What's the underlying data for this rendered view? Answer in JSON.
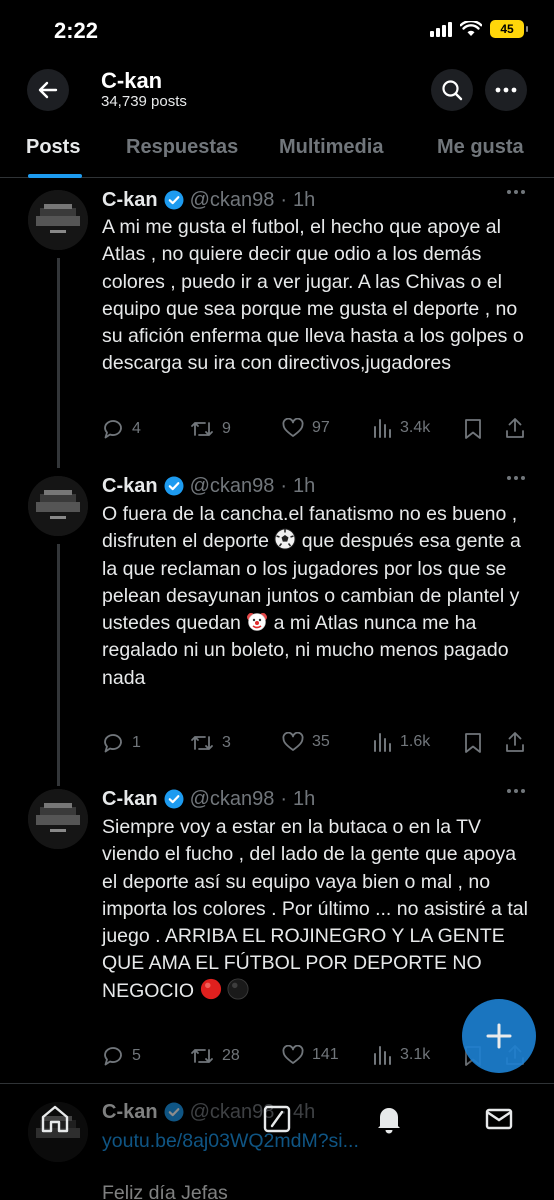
{
  "status_bar": {
    "time": "2:22",
    "battery": "45"
  },
  "header": {
    "title": "C-kan",
    "subtitle": "34,739 posts"
  },
  "tabs": [
    {
      "label": "Posts",
      "active": true
    },
    {
      "label": "Respuestas"
    },
    {
      "label": "Multimedia"
    },
    {
      "label": "Me gusta"
    }
  ],
  "posts": [
    {
      "name": "C-kan",
      "handle": "@ckan98",
      "age": "1h",
      "text": "A mi me gusta el futbol, el hecho que apoye al Atlas , no quiere decir que odio a los demás colores , puedo ir a ver jugar. A las Chivas o el equipo que sea porque me gusta el deporte , no su afición enferma que lleva hasta a los golpes o descarga su ira con directivos,jugadores",
      "replies": "4",
      "reposts": "9",
      "likes": "97",
      "views": "3.4k"
    },
    {
      "name": "C-kan",
      "handle": "@ckan98",
      "age": "1h",
      "text_a": "O fuera de la cancha.el fanatismo no es bueno , disfruten el deporte ",
      "text_b": " que después esa gente a la que reclaman o los jugadores por los que se pelean desayunan juntos o cambian de plantel y ustedes quedan ",
      "text_c": " a mi Atlas nunca me ha regalado ni un boleto, ni mucho menos pagado nada",
      "emoji_1": "soccer-ball-emoji",
      "emoji_2": "clown-face-emoji",
      "replies": "1",
      "reposts": "3",
      "likes": "35",
      "views": "1.6k"
    },
    {
      "name": "C-kan",
      "handle": "@ckan98",
      "age": "1h",
      "text": "Siempre voy a estar en la butaca o en la TV viendo el fucho , del lado de la gente que apoya el deporte así su equipo vaya bien o mal , no importa los colores . Por último ... no asistiré a tal juego . ARRIBA EL ROJINEGRO Y LA GENTE QUE AMA EL FÚTBOL POR DEPORTE NO NEGOCIO ",
      "emoji_1": "red-circle-emoji",
      "emoji_2": "black-circle-emoji",
      "replies": "5",
      "reposts": "28",
      "likes": "141",
      "views": "3.1k"
    },
    {
      "name": "C-kan",
      "handle": "@ckan98",
      "age": "4h",
      "link": "youtu.be/8aj03WQ2mdM?si...",
      "text": "Feliz día Jefas"
    }
  ],
  "colors": {
    "accent": "#1d9bf0",
    "verified": "#1d9bf0",
    "muted": "#71767b",
    "battery": "#ffd60a"
  },
  "icons": [
    "back-arrow-icon",
    "search-icon",
    "more-icon",
    "verified-badge-icon",
    "reply-icon",
    "repost-icon",
    "like-icon",
    "views-icon",
    "bookmark-icon",
    "share-icon",
    "compose-icon",
    "home-icon",
    "grok-icon",
    "notifications-icon",
    "messages-icon"
  ]
}
